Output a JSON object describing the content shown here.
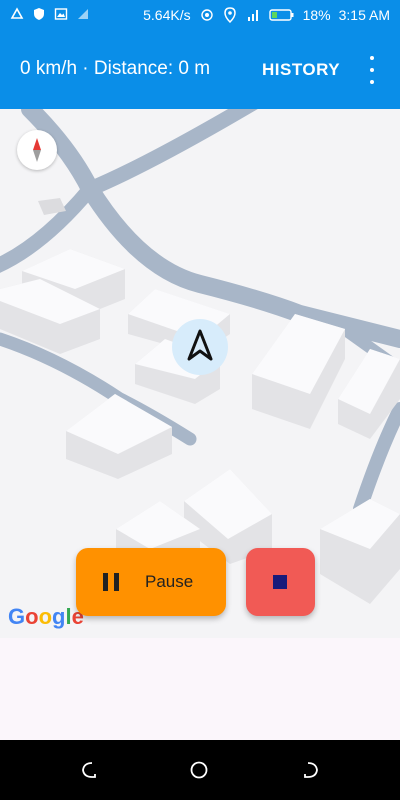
{
  "status_bar": {
    "network_speed": "5.64K/s",
    "battery": "18%",
    "time": "3:15 AM",
    "icons": [
      "triangle-icon",
      "shield-icon",
      "image-icon",
      "signal-icon",
      "hotspot-icon",
      "location-icon",
      "cell-signal-icon",
      "battery-icon"
    ]
  },
  "header": {
    "speed_distance": "0 km/h · Distance: 0 m",
    "history_label": "HISTORY",
    "menu_icon": "more-vert-icon"
  },
  "map": {
    "provider_logo": "Google",
    "compass_icon": "compass-icon",
    "location_marker_icon": "navigation-arrow-icon"
  },
  "controls": {
    "pause_label": "Pause",
    "pause_icon": "pause-icon",
    "stop_icon": "stop-icon"
  },
  "colors": {
    "primary": "#0a8ee8",
    "pause": "#ff9100",
    "stop": "#f15a55"
  },
  "system_nav": {
    "icons": [
      "back-icon",
      "home-icon",
      "recent-apps-icon"
    ]
  }
}
